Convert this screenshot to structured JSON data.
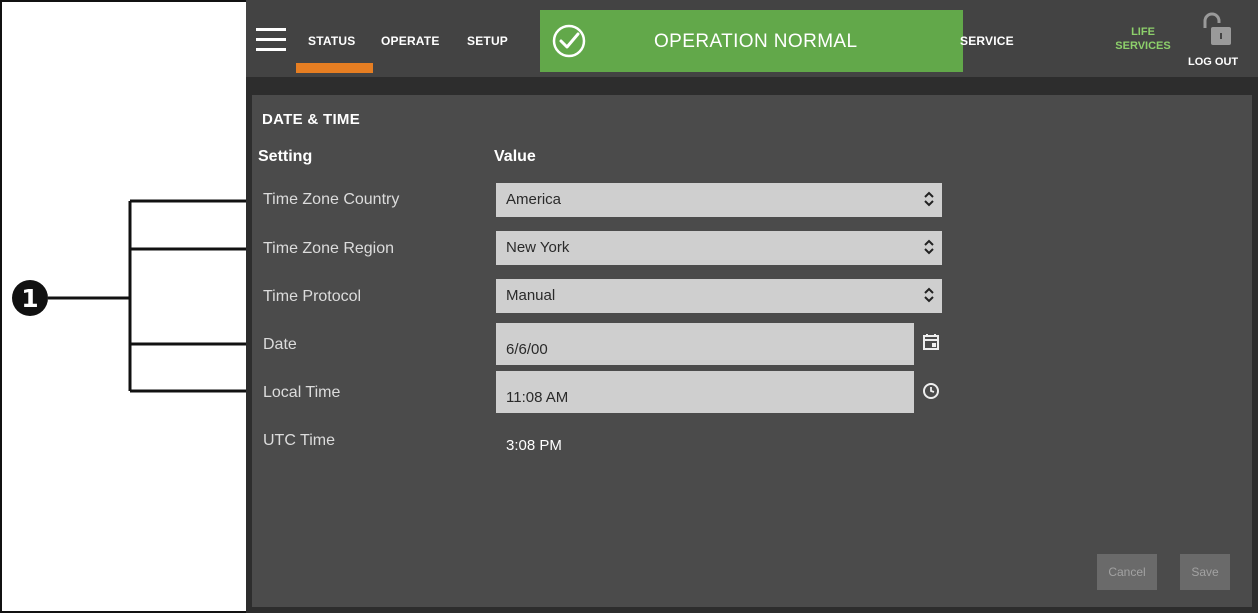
{
  "callout": {
    "number": "1"
  },
  "topbar": {
    "tabs": [
      {
        "label": "STATUS",
        "active": true
      },
      {
        "label": "OPERATE"
      },
      {
        "label": "SETUP"
      }
    ],
    "status_banner": {
      "text": "OPERATION NORMAL",
      "color": "#62a84a",
      "icon": "check-circle-icon"
    },
    "service_label": "SERVICE",
    "life_services_label": "LIFE SERVICES",
    "logout_label": "LOG OUT",
    "accent_color": "#e67e22"
  },
  "page": {
    "section_title": "DATE & TIME",
    "headers": {
      "setting": "Setting",
      "value": "Value"
    },
    "rows": [
      {
        "label": "Time Zone Country",
        "value": "America",
        "type": "select"
      },
      {
        "label": "Time Zone Region",
        "value": "New York",
        "type": "select"
      },
      {
        "label": "Time Protocol",
        "value": "Manual",
        "type": "select"
      },
      {
        "label": "Date",
        "value": "6/6/00",
        "type": "date",
        "icon": "calendar-icon"
      },
      {
        "label": "Local Time",
        "value": "11:08 AM",
        "type": "time",
        "icon": "clock-icon"
      },
      {
        "label": "UTC Time",
        "value": "3:08 PM",
        "type": "static"
      }
    ],
    "buttons": {
      "cancel": "Cancel",
      "save": "Save"
    }
  }
}
